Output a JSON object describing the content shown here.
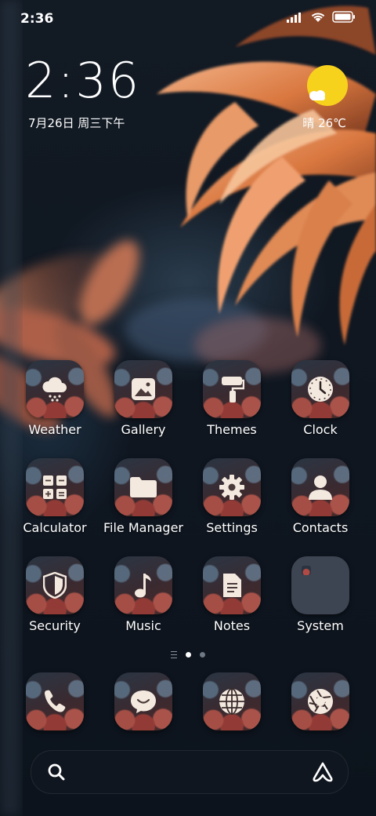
{
  "status_bar": {
    "time": "2:36",
    "icons": [
      "signal-icon",
      "wifi-icon",
      "battery-icon"
    ]
  },
  "clock_widget": {
    "time": "2:36",
    "date": "7月26日 周三下午"
  },
  "weather_widget": {
    "icon": "sunny-cloud-icon",
    "text": "晴 26℃",
    "sun_color": "#f7d21c"
  },
  "apps": [
    {
      "label": "Weather",
      "icon": "weather-icon"
    },
    {
      "label": "Gallery",
      "icon": "gallery-icon"
    },
    {
      "label": "Themes",
      "icon": "themes-icon"
    },
    {
      "label": "Clock",
      "icon": "clock-icon"
    },
    {
      "label": "Calculator",
      "icon": "calculator-icon"
    },
    {
      "label": "File Manager",
      "icon": "folder-icon"
    },
    {
      "label": "Settings",
      "icon": "gear-icon"
    },
    {
      "label": "Contacts",
      "icon": "contacts-icon"
    },
    {
      "label": "Security",
      "icon": "shield-icon"
    },
    {
      "label": "Music",
      "icon": "music-note-icon"
    },
    {
      "label": "Notes",
      "icon": "notes-icon"
    },
    {
      "label": "System",
      "icon": "folder-icon"
    }
  ],
  "page_indicator": {
    "pages": 2,
    "active": 1
  },
  "dock": [
    {
      "icon": "phone-icon"
    },
    {
      "icon": "message-icon"
    },
    {
      "icon": "browser-icon"
    },
    {
      "icon": "camera-icon"
    }
  ],
  "search_bar": {
    "placeholder": "",
    "left_icon": "search-icon",
    "right_icon": "assistant-icon"
  }
}
